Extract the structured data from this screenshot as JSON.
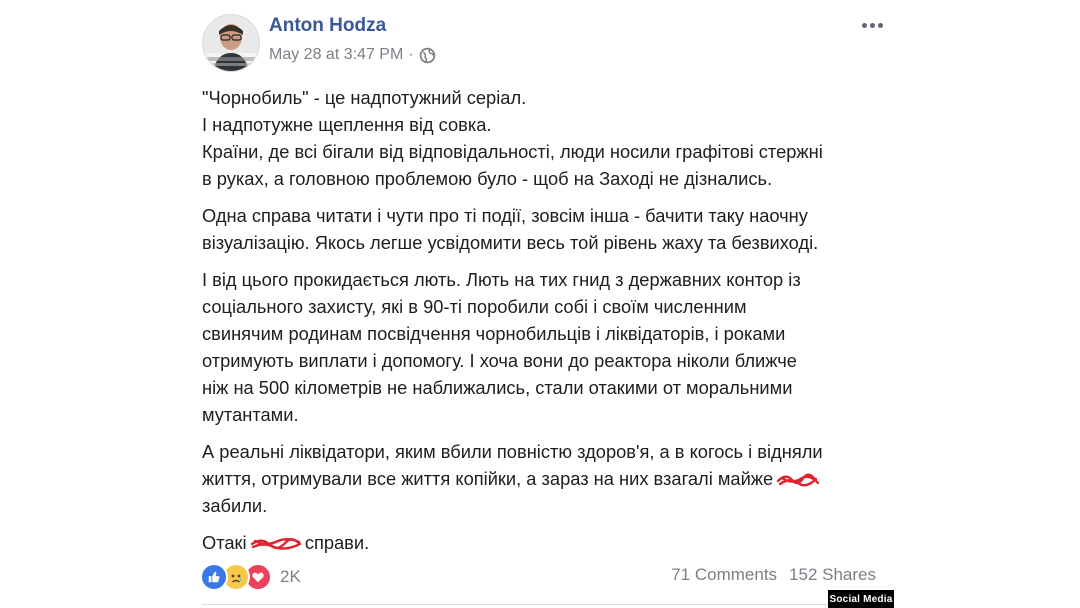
{
  "post": {
    "author": "Anton Hodza",
    "timestamp": "May 28 at 3:47 PM",
    "separator": "·",
    "privacy_icon": "globe-icon",
    "more_icon": "more-options-icon",
    "paragraphs": [
      {
        "lines": [
          "\"Чорнобиль\" - це надпотужний серіал.",
          "І надпотужне щеплення від совка.",
          "Країни, де всі бігали від відповідальності, люди носили графітові стержні",
          "в руках, а головною проблемою було - щоб на Заході не дізнались."
        ]
      },
      {
        "lines": [
          "Одна справа читати і чути про ті події, зовсім інша - бачити таку наочну",
          "візуалізацію. Якось легше усвідомити весь той рівень жаху та безвиході."
        ]
      },
      {
        "lines": [
          "І від цього прокидається лють. Лють на тих гнид з державних контор із",
          "соціального захисту, які в 90-ті поробили собі і своїм численним",
          "свинячим родинам посвідчення чорнобильців і ліквідаторів, і роками",
          "отримують виплати і допомогу. І хоча вони до реактора ніколи ближче",
          "ніж на 500 кілометрів не наближались, стали отакими от моральними",
          "мутантами."
        ]
      },
      {
        "lines": [
          "А реальні ліквідатори, яким вбили повністю здоров'я, а в когось і відняли",
          "життя, отримували все життя копійки, а зараз на них взагалі майже"
        ],
        "line3": "забили."
      }
    ],
    "last_line": {
      "before": "Отакі",
      "after": "справи."
    }
  },
  "footer": {
    "reaction_icons": [
      "like-icon",
      "sad-icon",
      "love-icon"
    ],
    "reaction_count": "2K",
    "comments": "71 Comments",
    "shares": "152 Shares"
  },
  "watermark": "Social Media",
  "colors": {
    "author": "#385898",
    "meta": "#7b7f85",
    "text": "#1c1e21",
    "scribble": "#e0242f",
    "like": "#3b78e7",
    "love": "#e9425a",
    "sad": "#f7c94a"
  }
}
